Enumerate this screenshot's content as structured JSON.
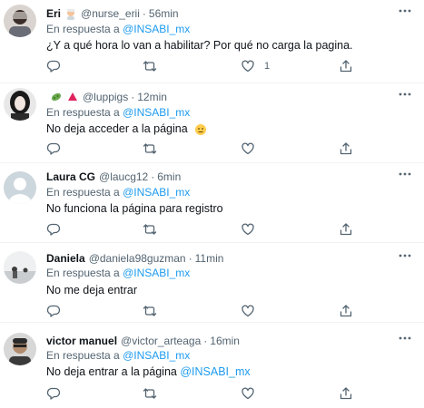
{
  "replying_label": "En respuesta a",
  "tweets": [
    {
      "name": "Eri",
      "handle": "@nurse_erii",
      "time": "56min",
      "mention": "@INSABI_mx",
      "text": "¿Y a qué hora lo van a habilitar? Por qué no carga la pagina.",
      "text_mention": "",
      "like_count": "1",
      "name_emojis": [
        "woman-health-worker-emoji"
      ]
    },
    {
      "name": "",
      "handle": "@luppigs",
      "time": "12min",
      "mention": "@INSABI_mx",
      "text": "No deja acceder a la página",
      "text_mention": "",
      "like_count": "",
      "name_emojis": [
        "microbe-emoji",
        "red-triangle-emoji"
      ]
    },
    {
      "name": "Laura CG",
      "handle": "@laucg12",
      "time": "6min",
      "mention": "@INSABI_mx",
      "text": "No funciona la página para registro",
      "text_mention": "",
      "like_count": "",
      "name_emojis": []
    },
    {
      "name": "Daniela",
      "handle": "@daniela98guzman",
      "time": "11min",
      "mention": "@INSABI_mx",
      "text": "No me deja entrar",
      "text_mention": "",
      "like_count": "",
      "name_emojis": []
    },
    {
      "name": "victor manuel",
      "handle": "@victor_arteaga",
      "time": "16min",
      "mention": "@INSABI_mx",
      "text": "No deja entrar a la página",
      "text_mention": "@INSABI_mx",
      "like_count": "",
      "name_emojis": []
    }
  ],
  "colors": {
    "accent": "#1d9bf0",
    "secondary": "#536471",
    "text": "#0f1419"
  }
}
